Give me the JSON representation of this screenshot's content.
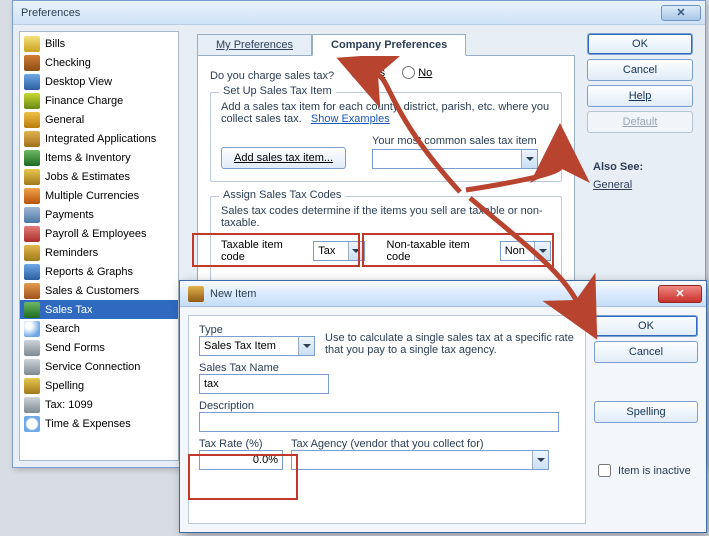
{
  "prefs": {
    "title": "Preferences",
    "tabs": {
      "my": "My Preferences",
      "company": "Company Preferences"
    },
    "buttons": {
      "ok": "OK",
      "cancel": "Cancel",
      "help": "Help",
      "default": "Default"
    },
    "also": {
      "heading": "Also See:",
      "link": "General"
    },
    "question": "Do you charge sales tax?",
    "yes": "Yes",
    "no": "No",
    "setup": {
      "legend": "Set Up Sales Tax Item",
      "hint": "Add a sales tax item for each county, district, parish, etc. where you collect sales tax.",
      "examples": "Show Examples",
      "addBtn": "Add sales tax item...",
      "commonLabel": "Your most common sales tax item"
    },
    "assign": {
      "legend": "Assign Sales Tax Codes",
      "hint": "Sales tax codes determine if the items you sell are taxable or non-taxable.",
      "taxLabel": "Taxable item code",
      "taxVal": "Tax",
      "nonLabel": "Non-taxable item code",
      "nonVal": "Non"
    },
    "sidebar": [
      "Bills",
      "Checking",
      "Desktop View",
      "Finance Charge",
      "General",
      "Integrated Applications",
      "Items & Inventory",
      "Jobs & Estimates",
      "Multiple Currencies",
      "Payments",
      "Payroll & Employees",
      "Reminders",
      "Reports & Graphs",
      "Sales & Customers",
      "Sales Tax",
      "Search",
      "Send Forms",
      "Service Connection",
      "Spelling",
      "Tax: 1099",
      "Time & Expenses"
    ],
    "sidebarSelected": 14
  },
  "item": {
    "title": "New Item",
    "buttons": {
      "ok": "OK",
      "cancel": "Cancel",
      "spelling": "Spelling"
    },
    "typeLabel": "Type",
    "typeVal": "Sales Tax Item",
    "typeHelp": "Use to calculate a single sales tax at a specific rate that you pay to a single tax agency.",
    "nameLabel": "Sales Tax Name",
    "nameVal": "tax",
    "descLabel": "Description",
    "descVal": "",
    "rateLabel": "Tax Rate (%)",
    "rateVal": "0.0%",
    "agencyLabel": "Tax Agency (vendor that you collect for)",
    "inactive": "Item is inactive"
  }
}
